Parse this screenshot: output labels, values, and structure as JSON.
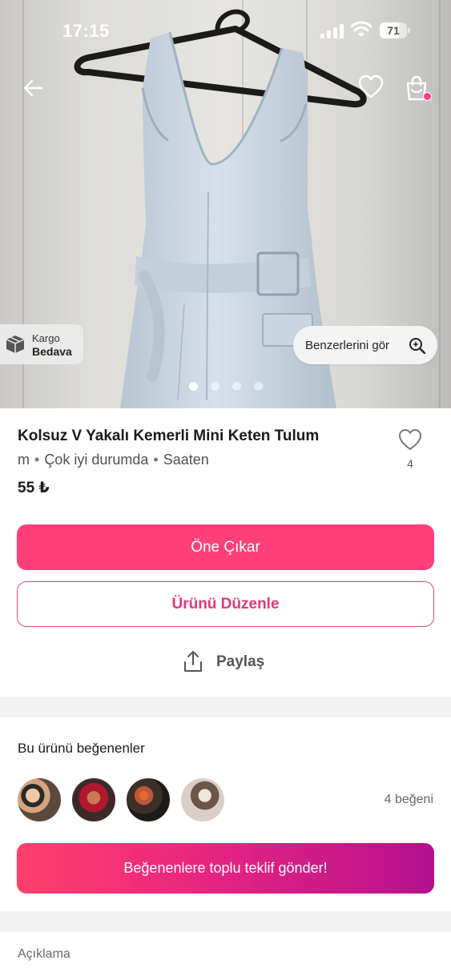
{
  "status_bar": {
    "time": "17:15",
    "battery": "71",
    "battery_level": 0.71
  },
  "hero": {
    "badge": {
      "line1": "Kargo",
      "line2": "Bedava"
    },
    "similar_button": "Benzerlerini gör",
    "image_count": 4,
    "active_index": 0
  },
  "product": {
    "title": "Kolsuz V Yakalı Kemerli Mini Keten Tulum",
    "size": "m",
    "condition": "Çok iyi durumda",
    "brand": "Saaten",
    "price": "55 ₺",
    "like_count": "4"
  },
  "actions": {
    "promote": "Öne Çıkar",
    "edit": "Ürünü Düzenle",
    "share": "Paylaş"
  },
  "likers": {
    "title": "Bu ürünü beğenenler",
    "count_label": "4 beğeni",
    "offer_button": "Beğenenlere toplu teklif gönder!"
  },
  "description": {
    "title": "Açıklama"
  },
  "colors": {
    "primary": "#ff3f7a",
    "outline": "#d34a84",
    "gradient_end": "#b3108f"
  }
}
